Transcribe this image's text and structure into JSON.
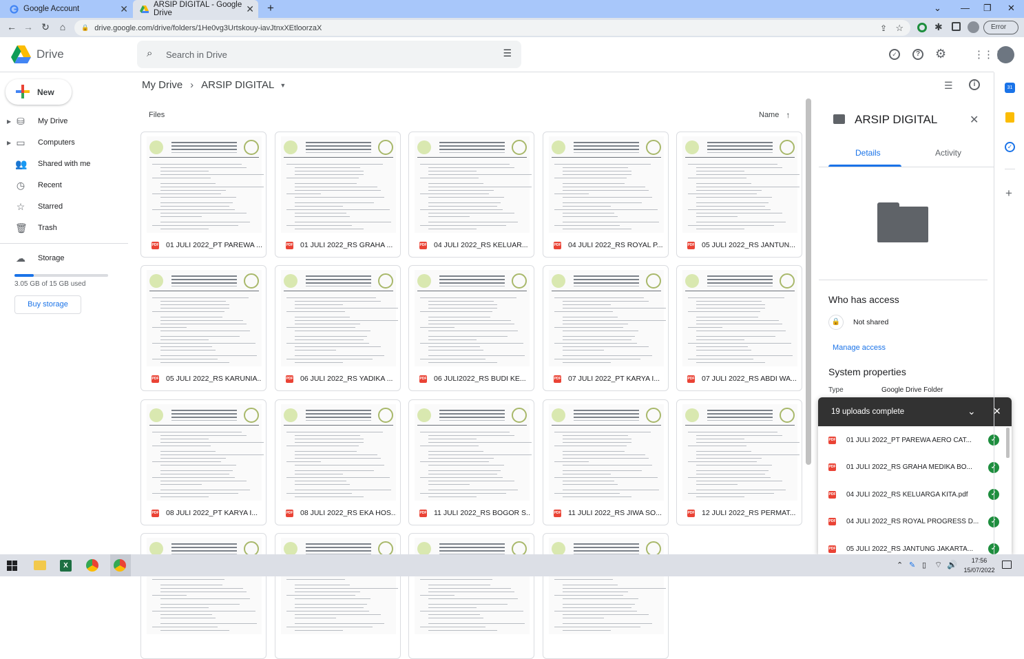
{
  "browser": {
    "tabs": [
      {
        "title": "Google Account"
      },
      {
        "title": "ARSIP DIGITAL - Google Drive"
      }
    ],
    "url": "drive.google.com/drive/folders/1He0vg3Urtskouy-iavJtnxXEtloorzaX",
    "profile_button": "Error"
  },
  "drive": {
    "app_name": "Drive",
    "search_placeholder": "Search in Drive",
    "new_label": "New",
    "nav": [
      {
        "label": "My Drive",
        "icon": "my-drive-icon"
      },
      {
        "label": "Computers",
        "icon": "computers-icon"
      },
      {
        "label": "Shared with me",
        "icon": "shared-icon"
      },
      {
        "label": "Recent",
        "icon": "clock-icon"
      },
      {
        "label": "Starred",
        "icon": "star-icon"
      },
      {
        "label": "Trash",
        "icon": "trash-icon"
      }
    ],
    "storage": {
      "label": "Storage",
      "used_text": "3.05 GB of 15 GB used",
      "fraction_used": 0.203,
      "buy_label": "Buy storage"
    },
    "breadcrumb": {
      "root": "My Drive",
      "current": "ARSIP DIGITAL"
    },
    "files_label": "Files",
    "sort_label": "Name",
    "files": [
      {
        "name": "01 JULI 2022_PT PAREWA ..."
      },
      {
        "name": "01 JULI 2022_RS GRAHA ..."
      },
      {
        "name": "04 JULI 2022_RS KELUAR..."
      },
      {
        "name": "04 JULI 2022_RS ROYAL P..."
      },
      {
        "name": "05 JULI 2022_RS JANTUN..."
      },
      {
        "name": "05 JULI 2022_RS KARUNIA..."
      },
      {
        "name": "06 JULI 2022_RS YADIKA ..."
      },
      {
        "name": "06 JULI2022_RS BUDI KE..."
      },
      {
        "name": "07 JULI 2022_PT KARYA I..."
      },
      {
        "name": "07 JULI 2022_RS ABDI WA..."
      },
      {
        "name": "08 JULI 2022_PT KARYA I..."
      },
      {
        "name": "08 JULI 2022_RS EKA HOS..."
      },
      {
        "name": "11 JULI 2022_RS BOGOR S..."
      },
      {
        "name": "11 JULI 2022_RS JIWA SO..."
      },
      {
        "name": "12 JULI 2022_RS PERMAT..."
      },
      {
        "name": ""
      },
      {
        "name": ""
      },
      {
        "name": ""
      },
      {
        "name": ""
      }
    ],
    "details": {
      "title": "ARSIP DIGITAL",
      "tab_details": "Details",
      "tab_activity": "Activity",
      "access_heading": "Who has access",
      "access_status": "Not shared",
      "manage_access": "Manage access",
      "sysprops_heading": "System properties",
      "type_label": "Type",
      "type_value": "Google Drive Folder"
    },
    "uploads": {
      "title": "19 uploads complete",
      "items": [
        "01 JULI 2022_PT PAREWA AERO CAT...",
        "01 JULI 2022_RS GRAHA MEDIKA BO...",
        "04 JULI 2022_RS KELUARGA KITA.pdf",
        "04 JULI 2022_RS ROYAL PROGRESS D...",
        "05 JULI 2022_RS JANTUNG JAKARTA..."
      ]
    }
  },
  "taskbar": {
    "time": "17:56",
    "date": "15/07/2022"
  },
  "colors": {
    "accent": "#1a73e8",
    "tabstrip": "#a8c7fa",
    "toolbar": "#dee3eb",
    "success": "#1e8e3e",
    "pdf": "#ea4335"
  }
}
